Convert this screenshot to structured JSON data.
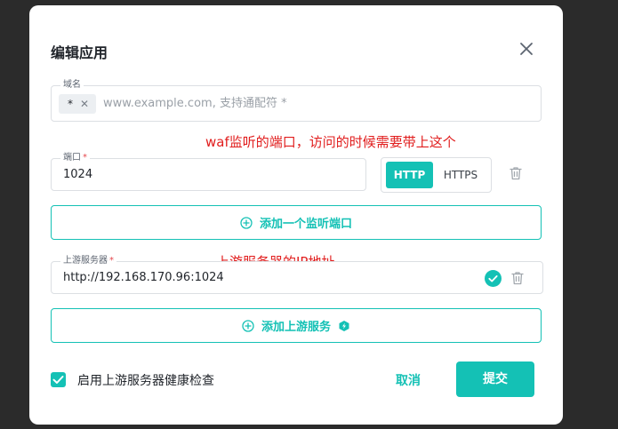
{
  "dialog": {
    "title": "编辑应用",
    "domain": {
      "label": "域名",
      "chip": "*",
      "placeholder": "www.example.com, 支持通配符 *"
    },
    "port": {
      "label": "端口",
      "value": "1024",
      "protocols": [
        "HTTP",
        "HTTPS"
      ],
      "selected": "HTTP"
    },
    "annotation_port": "waf监听的端口，访问的时候需要带上这个",
    "add_port_label": "添加一个监听端口",
    "upstream": {
      "label": "上游服务器",
      "value": "http://192.168.170.96:1024"
    },
    "annotation_upstream": "上游服务器的IP地址",
    "add_upstream_label": "添加上游服务",
    "health_check_label": "启用上游服务器健康检查",
    "health_check_checked": true,
    "cancel_label": "取消",
    "submit_label": "提交"
  },
  "colors": {
    "accent": "#14c1b5",
    "annotation": "#e11d1d",
    "required": "#e5484d"
  }
}
